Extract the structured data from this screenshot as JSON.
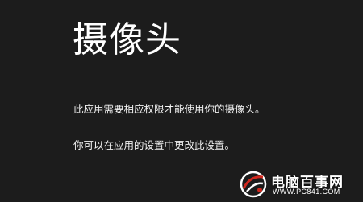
{
  "dialog": {
    "title": "摄像头",
    "message_line1": "此应用需要相应权限才能使用你的摄像头。",
    "message_line2": "你可以在应用的设置中更改此设置。"
  },
  "watermark": {
    "site_name": "电脑百事网",
    "url": "WWW.PC841.COM",
    "logo_icon": "pc841-logo-icon"
  },
  "colors": {
    "background": "#1c1c1c",
    "text": "#ffffff",
    "watermark_accent": "#d0281e"
  }
}
